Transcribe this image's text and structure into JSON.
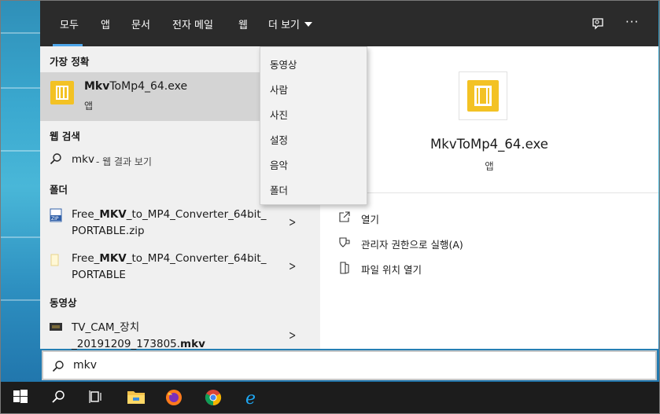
{
  "tabs": [
    {
      "label": "모두"
    },
    {
      "label": "앱"
    },
    {
      "label": "문서"
    },
    {
      "label": "전자 메일"
    },
    {
      "label": "웹"
    },
    {
      "label": "더 보기"
    }
  ],
  "topbar_icons": [
    "feedback-icon",
    "more-options-icon"
  ],
  "topbar_more_glyph": "···",
  "sections": {
    "best_match": "가장 정확",
    "web_search": "웹 검색",
    "folders": "폴더",
    "videos": "동영상"
  },
  "best_match": {
    "name_bold": "Mkv",
    "name_rest": "ToMp4_64.exe",
    "type": "앱"
  },
  "web_search": {
    "query": "mkv",
    "suffix": " - 웹 결과 보기"
  },
  "folders": [
    {
      "line1_pre": "Free_",
      "line1_bold": "MKV",
      "line1_post": "_to_MP4_Converter_64bit_",
      "line2": "PORTABLE.zip",
      "icon": "zip-icon"
    },
    {
      "line1_pre": "Free_",
      "line1_bold": "MKV",
      "line1_post": "_to_MP4_Converter_64bit_",
      "line2": "PORTABLE",
      "icon": "folder-icon"
    }
  ],
  "videos": [
    {
      "line1": "TV_CAM_장치",
      "line2_pre": "_20191209_173805.",
      "line2_bold": "mkv",
      "icon": "video-icon"
    }
  ],
  "dropdown_items": [
    "동영상",
    "사람",
    "사진",
    "설정",
    "음악",
    "폴더"
  ],
  "preview": {
    "title": "MkvToMp4_64.exe",
    "subtitle": "앱",
    "actions": [
      {
        "label": "열기",
        "icon": "open-icon"
      },
      {
        "label": "관리자 권한으로 실행(A)",
        "icon": "shield-icon"
      },
      {
        "label": "파일 위치 열기",
        "icon": "file-location-icon"
      }
    ]
  },
  "search_box": {
    "value": "mkv"
  },
  "taskbar": [
    "start-icon",
    "search-icon",
    "task-view-icon",
    "file-explorer-icon",
    "firefox-icon",
    "chrome-icon",
    "edge-icon"
  ],
  "colors": {
    "accent": "#4ea6ea",
    "app_yellow": "#f3c224",
    "topbar": "#2b2b2b"
  }
}
